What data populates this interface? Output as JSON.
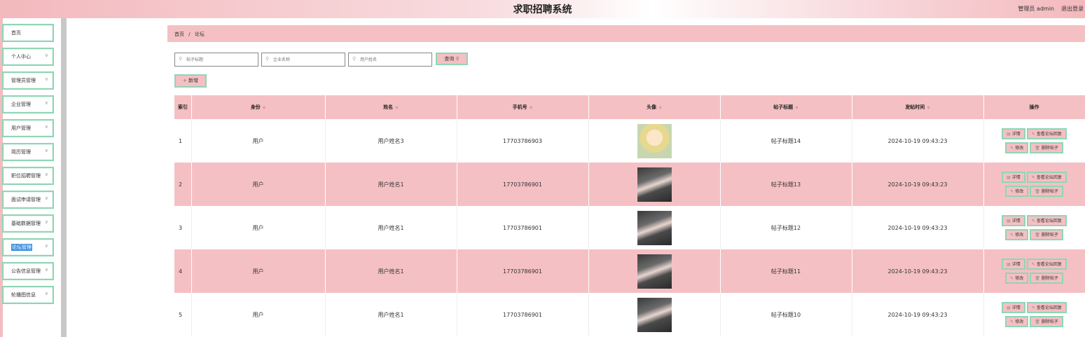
{
  "header": {
    "title": "求职招聘系统",
    "user": "管理员 admin",
    "logout": "退出登录"
  },
  "sidebar": {
    "items": [
      {
        "label": "首页",
        "chevron": false
      },
      {
        "label": "个人中心",
        "chevron": true
      },
      {
        "label": "管理员管理",
        "chevron": true
      },
      {
        "label": "企业管理",
        "chevron": true
      },
      {
        "label": "用户管理",
        "chevron": true
      },
      {
        "label": "简历管理",
        "chevron": true
      },
      {
        "label": "职位招聘管理",
        "chevron": true
      },
      {
        "label": "面试申请管理",
        "chevron": true
      },
      {
        "label": "基础数据管理",
        "chevron": true
      },
      {
        "label": "论坛管理",
        "chevron": true,
        "active": true
      },
      {
        "label": "公告信息管理",
        "chevron": true
      },
      {
        "label": "轮播图信息",
        "chevron": true
      }
    ]
  },
  "breadcrumb": {
    "home": "首页",
    "separator": "/",
    "current": "论坛"
  },
  "search": {
    "title_placeholder": "帖子标题",
    "company_placeholder": "企业名称",
    "user_placeholder": "用户姓名",
    "query_label": "查询",
    "add_label": "新增"
  },
  "table": {
    "columns": [
      "索引",
      "身份",
      "姓名",
      "手机号",
      "头像",
      "帖子标题",
      "发帖时间",
      "操作"
    ],
    "rows": [
      {
        "index": "1",
        "role": "用户",
        "name": "用户姓名3",
        "phone": "17703786903",
        "avatar": "green",
        "title": "帖子标题14",
        "time": "2024-10-19 09:43:23"
      },
      {
        "index": "2",
        "role": "用户",
        "name": "用户姓名1",
        "phone": "17703786901",
        "avatar": "dark",
        "title": "帖子标题13",
        "time": "2024-10-19 09:43:23"
      },
      {
        "index": "3",
        "role": "用户",
        "name": "用户姓名1",
        "phone": "17703786901",
        "avatar": "dark",
        "title": "帖子标题12",
        "time": "2024-10-19 09:43:23"
      },
      {
        "index": "4",
        "role": "用户",
        "name": "用户姓名1",
        "phone": "17703786901",
        "avatar": "dark",
        "title": "帖子标题11",
        "time": "2024-10-19 09:43:23"
      },
      {
        "index": "5",
        "role": "用户",
        "name": "用户姓名1",
        "phone": "17703786901",
        "avatar": "dark",
        "title": "帖子标题10",
        "time": "2024-10-19 09:43:23"
      }
    ],
    "actions": {
      "detail": "详情",
      "replies": "查看论坛回复",
      "edit": "修改",
      "delete": "删除帖子"
    }
  },
  "colors": {
    "accent": "#f5c0c3",
    "border": "#8fd6b5",
    "active": "#3d8fe0"
  }
}
